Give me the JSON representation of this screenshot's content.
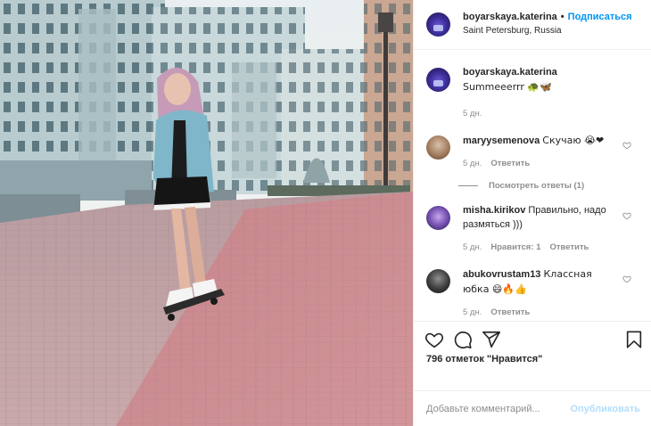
{
  "post": {
    "username": "boyarskaya.katerina",
    "follow_label": "Подписаться",
    "location": "Saint Petersburg, Russia",
    "caption_text": "Summeeerrr 🐢🦋",
    "caption_time": "5 дн."
  },
  "comments": [
    {
      "username": "maryysemenova",
      "text": "Скучаю 😭❤",
      "time": "5 дн.",
      "reply_label": "Ответить",
      "likes_label": ""
    },
    {
      "username": "misha.kirikov",
      "text": "Правильно, надо размяться )))",
      "time": "5 дн.",
      "likes_label": "Нравится: 1",
      "reply_label": "Ответить"
    },
    {
      "username": "abukovrustam13",
      "text": "Классная юбка 😄🔥👍",
      "time": "5 дн.",
      "reply_label": "Ответить",
      "likes_label": ""
    }
  ],
  "view_replies_label": "Посмотреть ответы (1)",
  "likes_text": "796 отметок \"Нравится\"",
  "comment_input": {
    "placeholder": "Добавьте комментарий...",
    "value": ""
  },
  "publish_label": "Опубликовать",
  "icons": [
    "heart-icon",
    "comment-icon",
    "share-icon",
    "bookmark-icon"
  ],
  "colors": {
    "accent": "#0095f6",
    "publish_disabled": "#b2dffc",
    "muted": "#8e8e8e"
  }
}
